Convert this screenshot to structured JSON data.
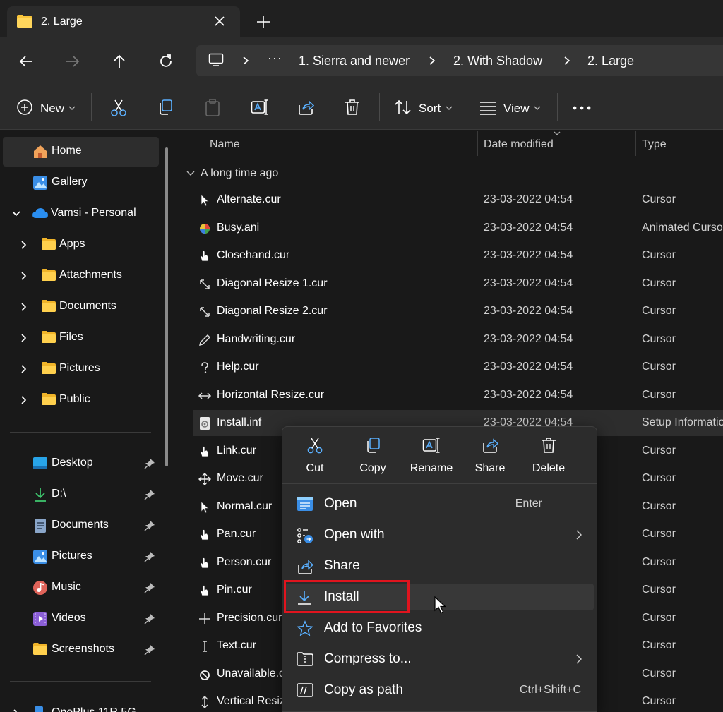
{
  "tab": {
    "title": "2. Large"
  },
  "address": {
    "overflow": "···",
    "segments": [
      "1. Sierra and newer",
      "2. With Shadow",
      "2. Large"
    ]
  },
  "commandbar": {
    "new_label": "New",
    "sort_label": "Sort",
    "view_label": "View"
  },
  "nav": {
    "pinned_top": [
      {
        "label": "Home",
        "icon": "home-icon",
        "selected": true
      },
      {
        "label": "Gallery",
        "icon": "gallery-icon"
      }
    ],
    "onedrive": {
      "label": "Vamsi - Personal",
      "icon": "cloud-icon"
    },
    "folders": [
      "Apps",
      "Attachments",
      "Documents",
      "Files",
      "Pictures",
      "Public"
    ],
    "quick_access": [
      {
        "label": "Desktop",
        "icon": "desktop-icon"
      },
      {
        "label": "D:\\",
        "icon": "download-icon"
      },
      {
        "label": "Documents",
        "icon": "document-icon"
      },
      {
        "label": "Pictures",
        "icon": "pictures-icon"
      },
      {
        "label": "Music",
        "icon": "music-icon"
      },
      {
        "label": "Videos",
        "icon": "videos-icon"
      },
      {
        "label": "Screenshots",
        "icon": "folder-icon"
      }
    ],
    "bottom_partial": "OnePlus 11R 5G"
  },
  "columns": {
    "name": "Name",
    "date": "Date modified",
    "type": "Type"
  },
  "group": {
    "label": "A long time ago"
  },
  "files": [
    {
      "name": "Alternate.cur",
      "date": "23-03-2022 04:54",
      "type": "Cursor",
      "icon": "alternate-cursor-icon"
    },
    {
      "name": "Busy.ani",
      "date": "23-03-2022 04:54",
      "type": "Animated Cursor",
      "icon": "busy-cursor-icon"
    },
    {
      "name": "Closehand.cur",
      "date": "23-03-2022 04:54",
      "type": "Cursor",
      "icon": "closehand-cursor-icon"
    },
    {
      "name": "Diagonal Resize 1.cur",
      "date": "23-03-2022 04:54",
      "type": "Cursor",
      "icon": "diagonal-resize-cursor-icon"
    },
    {
      "name": "Diagonal Resize 2.cur",
      "date": "23-03-2022 04:54",
      "type": "Cursor",
      "icon": "diagonal-resize-cursor-icon"
    },
    {
      "name": "Handwriting.cur",
      "date": "23-03-2022 04:54",
      "type": "Cursor",
      "icon": "handwriting-cursor-icon"
    },
    {
      "name": "Help.cur",
      "date": "23-03-2022 04:54",
      "type": "Cursor",
      "icon": "help-cursor-icon"
    },
    {
      "name": "Horizontal Resize.cur",
      "date": "23-03-2022 04:54",
      "type": "Cursor",
      "icon": "horizontal-resize-cursor-icon"
    },
    {
      "name": "Install.inf",
      "date": "23-03-2022 04:54",
      "type": "Setup Information",
      "icon": "setup-file-icon"
    },
    {
      "name": "Link.cur",
      "date": "",
      "type": "Cursor",
      "icon": "link-cursor-icon"
    },
    {
      "name": "Move.cur",
      "date": "",
      "type": "Cursor",
      "icon": "move-cursor-icon"
    },
    {
      "name": "Normal.cur",
      "date": "",
      "type": "Cursor",
      "icon": "normal-cursor-icon"
    },
    {
      "name": "Pan.cur",
      "date": "",
      "type": "Cursor",
      "icon": "pan-cursor-icon"
    },
    {
      "name": "Person.cur",
      "date": "",
      "type": "Cursor",
      "icon": "person-cursor-icon"
    },
    {
      "name": "Pin.cur",
      "date": "",
      "type": "Cursor",
      "icon": "pin-cursor-icon"
    },
    {
      "name": "Precision.cur",
      "date": "",
      "type": "Cursor",
      "icon": "precision-cursor-icon"
    },
    {
      "name": "Text.cur",
      "date": "",
      "type": "Cursor",
      "icon": "text-cursor-icon"
    },
    {
      "name": "Unavailable.cur",
      "date": "",
      "type": "Cursor",
      "icon": "unavailable-cursor-icon"
    },
    {
      "name": "Vertical Resize.cur",
      "date": "",
      "type": "Cursor",
      "icon": "vertical-resize-cursor-icon"
    }
  ],
  "context_menu": {
    "quick_actions": [
      "Cut",
      "Copy",
      "Rename",
      "Share",
      "Delete"
    ],
    "items": [
      {
        "label": "Open",
        "shortcut": "Enter",
        "icon": "open-icon"
      },
      {
        "label": "Open with",
        "submenu": true,
        "icon": "open-with-icon"
      },
      {
        "label": "Share",
        "icon": "share-icon"
      },
      {
        "label": "Install",
        "icon": "install-icon",
        "hovered": true
      },
      {
        "label": "Add to Favorites",
        "icon": "star-icon"
      },
      {
        "label": "Compress to...",
        "submenu": true,
        "icon": "compress-icon"
      },
      {
        "label": "Copy as path",
        "shortcut": "Ctrl+Shift+C",
        "icon": "copy-path-icon"
      }
    ]
  },
  "colors": {
    "highlight_border": "#e0141e",
    "accent": "#4cc2ff",
    "folder": "#f8c43a"
  }
}
